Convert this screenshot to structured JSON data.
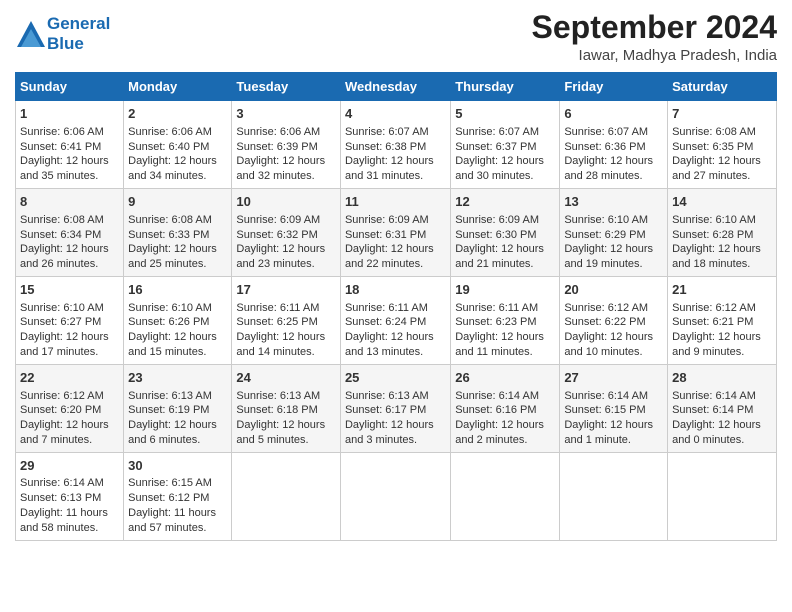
{
  "header": {
    "logo_line1": "General",
    "logo_line2": "Blue",
    "month_title": "September 2024",
    "location": "Iawar, Madhya Pradesh, India"
  },
  "days_of_week": [
    "Sunday",
    "Monday",
    "Tuesday",
    "Wednesday",
    "Thursday",
    "Friday",
    "Saturday"
  ],
  "weeks": [
    [
      {
        "day": "1",
        "lines": [
          "Sunrise: 6:06 AM",
          "Sunset: 6:41 PM",
          "Daylight: 12 hours",
          "and 35 minutes."
        ]
      },
      {
        "day": "2",
        "lines": [
          "Sunrise: 6:06 AM",
          "Sunset: 6:40 PM",
          "Daylight: 12 hours",
          "and 34 minutes."
        ]
      },
      {
        "day": "3",
        "lines": [
          "Sunrise: 6:06 AM",
          "Sunset: 6:39 PM",
          "Daylight: 12 hours",
          "and 32 minutes."
        ]
      },
      {
        "day": "4",
        "lines": [
          "Sunrise: 6:07 AM",
          "Sunset: 6:38 PM",
          "Daylight: 12 hours",
          "and 31 minutes."
        ]
      },
      {
        "day": "5",
        "lines": [
          "Sunrise: 6:07 AM",
          "Sunset: 6:37 PM",
          "Daylight: 12 hours",
          "and 30 minutes."
        ]
      },
      {
        "day": "6",
        "lines": [
          "Sunrise: 6:07 AM",
          "Sunset: 6:36 PM",
          "Daylight: 12 hours",
          "and 28 minutes."
        ]
      },
      {
        "day": "7",
        "lines": [
          "Sunrise: 6:08 AM",
          "Sunset: 6:35 PM",
          "Daylight: 12 hours",
          "and 27 minutes."
        ]
      }
    ],
    [
      {
        "day": "8",
        "lines": [
          "Sunrise: 6:08 AM",
          "Sunset: 6:34 PM",
          "Daylight: 12 hours",
          "and 26 minutes."
        ]
      },
      {
        "day": "9",
        "lines": [
          "Sunrise: 6:08 AM",
          "Sunset: 6:33 PM",
          "Daylight: 12 hours",
          "and 25 minutes."
        ]
      },
      {
        "day": "10",
        "lines": [
          "Sunrise: 6:09 AM",
          "Sunset: 6:32 PM",
          "Daylight: 12 hours",
          "and 23 minutes."
        ]
      },
      {
        "day": "11",
        "lines": [
          "Sunrise: 6:09 AM",
          "Sunset: 6:31 PM",
          "Daylight: 12 hours",
          "and 22 minutes."
        ]
      },
      {
        "day": "12",
        "lines": [
          "Sunrise: 6:09 AM",
          "Sunset: 6:30 PM",
          "Daylight: 12 hours",
          "and 21 minutes."
        ]
      },
      {
        "day": "13",
        "lines": [
          "Sunrise: 6:10 AM",
          "Sunset: 6:29 PM",
          "Daylight: 12 hours",
          "and 19 minutes."
        ]
      },
      {
        "day": "14",
        "lines": [
          "Sunrise: 6:10 AM",
          "Sunset: 6:28 PM",
          "Daylight: 12 hours",
          "and 18 minutes."
        ]
      }
    ],
    [
      {
        "day": "15",
        "lines": [
          "Sunrise: 6:10 AM",
          "Sunset: 6:27 PM",
          "Daylight: 12 hours",
          "and 17 minutes."
        ]
      },
      {
        "day": "16",
        "lines": [
          "Sunrise: 6:10 AM",
          "Sunset: 6:26 PM",
          "Daylight: 12 hours",
          "and 15 minutes."
        ]
      },
      {
        "day": "17",
        "lines": [
          "Sunrise: 6:11 AM",
          "Sunset: 6:25 PM",
          "Daylight: 12 hours",
          "and 14 minutes."
        ]
      },
      {
        "day": "18",
        "lines": [
          "Sunrise: 6:11 AM",
          "Sunset: 6:24 PM",
          "Daylight: 12 hours",
          "and 13 minutes."
        ]
      },
      {
        "day": "19",
        "lines": [
          "Sunrise: 6:11 AM",
          "Sunset: 6:23 PM",
          "Daylight: 12 hours",
          "and 11 minutes."
        ]
      },
      {
        "day": "20",
        "lines": [
          "Sunrise: 6:12 AM",
          "Sunset: 6:22 PM",
          "Daylight: 12 hours",
          "and 10 minutes."
        ]
      },
      {
        "day": "21",
        "lines": [
          "Sunrise: 6:12 AM",
          "Sunset: 6:21 PM",
          "Daylight: 12 hours",
          "and 9 minutes."
        ]
      }
    ],
    [
      {
        "day": "22",
        "lines": [
          "Sunrise: 6:12 AM",
          "Sunset: 6:20 PM",
          "Daylight: 12 hours",
          "and 7 minutes."
        ]
      },
      {
        "day": "23",
        "lines": [
          "Sunrise: 6:13 AM",
          "Sunset: 6:19 PM",
          "Daylight: 12 hours",
          "and 6 minutes."
        ]
      },
      {
        "day": "24",
        "lines": [
          "Sunrise: 6:13 AM",
          "Sunset: 6:18 PM",
          "Daylight: 12 hours",
          "and 5 minutes."
        ]
      },
      {
        "day": "25",
        "lines": [
          "Sunrise: 6:13 AM",
          "Sunset: 6:17 PM",
          "Daylight: 12 hours",
          "and 3 minutes."
        ]
      },
      {
        "day": "26",
        "lines": [
          "Sunrise: 6:14 AM",
          "Sunset: 6:16 PM",
          "Daylight: 12 hours",
          "and 2 minutes."
        ]
      },
      {
        "day": "27",
        "lines": [
          "Sunrise: 6:14 AM",
          "Sunset: 6:15 PM",
          "Daylight: 12 hours",
          "and 1 minute."
        ]
      },
      {
        "day": "28",
        "lines": [
          "Sunrise: 6:14 AM",
          "Sunset: 6:14 PM",
          "Daylight: 12 hours",
          "and 0 minutes."
        ]
      }
    ],
    [
      {
        "day": "29",
        "lines": [
          "Sunrise: 6:14 AM",
          "Sunset: 6:13 PM",
          "Daylight: 11 hours",
          "and 58 minutes."
        ]
      },
      {
        "day": "30",
        "lines": [
          "Sunrise: 6:15 AM",
          "Sunset: 6:12 PM",
          "Daylight: 11 hours",
          "and 57 minutes."
        ]
      },
      {
        "day": "",
        "lines": []
      },
      {
        "day": "",
        "lines": []
      },
      {
        "day": "",
        "lines": []
      },
      {
        "day": "",
        "lines": []
      },
      {
        "day": "",
        "lines": []
      }
    ]
  ]
}
